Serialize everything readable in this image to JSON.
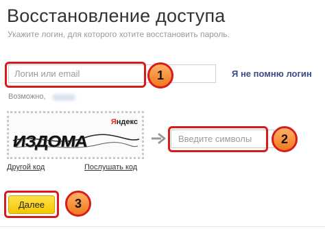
{
  "page": {
    "title": "Восстановление доступа",
    "subtitle": "Укажите логин, для которого хотите восстановить пароль."
  },
  "login": {
    "placeholder": "Логин или email",
    "value": "",
    "forgot_link": "Я не помню логин",
    "hint": "Возможно,"
  },
  "captcha": {
    "brand_first_letter": "Я",
    "brand_rest": "ндекс",
    "text": "ИЗДОМА",
    "other_code": "Другой код",
    "listen_code": "Послушать код",
    "input_placeholder": "Введите символы"
  },
  "actions": {
    "submit_label": "Далее"
  },
  "callouts": [
    "1",
    "2",
    "3"
  ],
  "colors": {
    "highlight": "#d91a1a",
    "callout_fill": "#f07a1e",
    "button": "#f5c800",
    "link": "#3a4a8a",
    "captcha_brand_red": "#e8271c"
  }
}
